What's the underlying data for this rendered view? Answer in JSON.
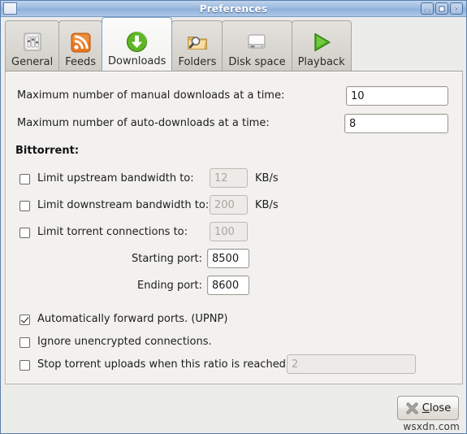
{
  "window": {
    "title": "Preferences",
    "menu_icon": "window-menu-icon",
    "buttons": [
      {
        "name": "minimize",
        "glyph": "minimize-icon"
      },
      {
        "name": "maximize",
        "glyph": "maximize-icon"
      },
      {
        "name": "close",
        "glyph": "close-icon"
      }
    ]
  },
  "tabs": [
    {
      "label": "General",
      "icon": "sliders-icon",
      "active": false
    },
    {
      "label": "Feeds",
      "icon": "rss-feed-icon",
      "active": false
    },
    {
      "label": "Downloads",
      "icon": "download-arrow-icon",
      "active": true
    },
    {
      "label": "Folders",
      "icon": "folder-search-icon",
      "active": false
    },
    {
      "label": "Disk space",
      "icon": "hard-drive-icon",
      "active": false
    },
    {
      "label": "Playback",
      "icon": "play-triangle-icon",
      "active": false
    }
  ],
  "downloads": {
    "max_manual_label": "Maximum number of manual downloads at a time:",
    "max_manual_value": "10",
    "max_auto_label": "Maximum number of auto-downloads at a time:",
    "max_auto_value": "8",
    "bittorrent_heading": "Bittorrent:",
    "limit_upstream_label": "Limit upstream bandwidth to:",
    "limit_upstream_value": "12",
    "limit_upstream_unit": "KB/s",
    "limit_upstream_checked": false,
    "limit_upstream_enabled": false,
    "limit_downstream_label": "Limit downstream bandwidth to:",
    "limit_downstream_value": "200",
    "limit_downstream_unit": "KB/s",
    "limit_downstream_checked": false,
    "limit_downstream_enabled": false,
    "limit_connections_label": "Limit torrent connections to:",
    "limit_connections_value": "100",
    "limit_connections_checked": false,
    "limit_connections_enabled": false,
    "starting_port_label": "Starting port:",
    "starting_port_value": "8500",
    "ending_port_label": "Ending port:",
    "ending_port_value": "8600",
    "upnp_label": "Automatically forward ports.  (UPNP)",
    "upnp_checked": true,
    "ignore_unencrypted_label": "Ignore unencrypted connections.",
    "ignore_unencrypted_checked": false,
    "stop_ratio_label": "Stop torrent uploads when this ratio is reached:",
    "stop_ratio_value": "2",
    "stop_ratio_checked": false,
    "stop_ratio_enabled": false
  },
  "actions": {
    "close_label": "Close",
    "close_mnemonic": "C",
    "close_rest": "lose",
    "close_icon": "x-cross-icon"
  },
  "watermark": "wsxdn.com",
  "colors": {
    "titlebar_accent": "#9dbbe0",
    "active_tab_border": "#7ba2cc",
    "panel_bg": "#f2f1ef",
    "window_bg": "#ececea",
    "disabled_text": "#a9a6a0"
  }
}
